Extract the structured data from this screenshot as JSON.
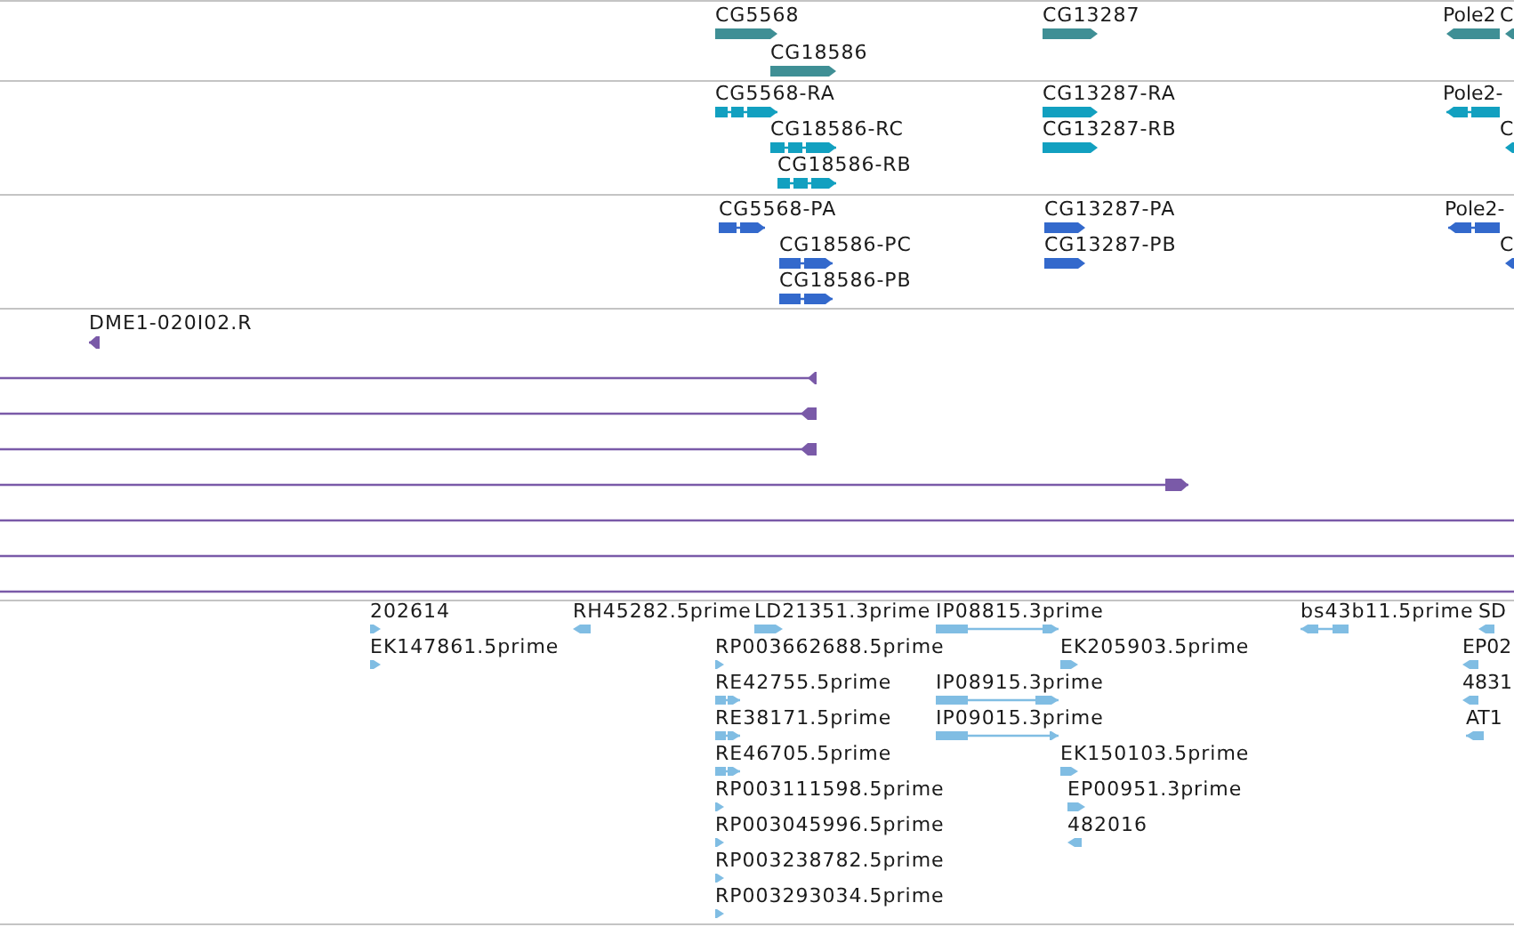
{
  "tracks": [
    {
      "kind": "gene",
      "color": "#3f8f95",
      "features": [
        {
          "label": "CG5568",
          "reverse": false
        },
        {
          "label": "CG18586",
          "reverse": false
        },
        {
          "label": "CG13287",
          "reverse": false
        },
        {
          "label": "Pole2",
          "reverse": true
        },
        {
          "label": "C",
          "reverse": true
        }
      ]
    },
    {
      "kind": "transcript",
      "color": "#12a0c0",
      "features": [
        {
          "label": "CG5568-RA",
          "reverse": false
        },
        {
          "label": "CG18586-RC",
          "reverse": false
        },
        {
          "label": "CG18586-RB",
          "reverse": false
        },
        {
          "label": "CG13287-RA",
          "reverse": false
        },
        {
          "label": "CG13287-RB",
          "reverse": false
        },
        {
          "label": "Pole2-",
          "reverse": true
        },
        {
          "label": "C",
          "reverse": true
        }
      ]
    },
    {
      "kind": "protein",
      "color": "#3369cc",
      "features": [
        {
          "label": "CG5568-PA",
          "reverse": false
        },
        {
          "label": "CG18586-PC",
          "reverse": false
        },
        {
          "label": "CG18586-PB",
          "reverse": false
        },
        {
          "label": "CG13287-PA",
          "reverse": false
        },
        {
          "label": "CG13287-PB",
          "reverse": false
        },
        {
          "label": "Pole2-",
          "reverse": true
        },
        {
          "label": "C",
          "reverse": true
        }
      ]
    },
    {
      "kind": "alignment",
      "color": "#7a5aa8",
      "features": [
        {
          "kind": "arrow",
          "label": "DME1-020I02.R",
          "reverse": true
        },
        {
          "kind": "arrow",
          "reverse": true
        },
        {
          "kind": "arrow",
          "reverse": true
        },
        {
          "kind": "arrow",
          "reverse": true
        },
        {
          "kind": "arrow",
          "reverse": false
        },
        {
          "kind": "line"
        },
        {
          "kind": "line"
        },
        {
          "kind": "line"
        }
      ]
    },
    {
      "kind": "est",
      "color": "#80bde3",
      "features": [
        {
          "label": "202614",
          "reverse": false
        },
        {
          "label": "EK147861.5prime",
          "reverse": false
        },
        {
          "label": "RH45282.5prime",
          "reverse": true
        },
        {
          "label": "LD21351.3prime",
          "reverse": false
        },
        {
          "label": "IP08815.3prime",
          "reverse": false
        },
        {
          "label": "RP003662688.5prime",
          "reverse": false
        },
        {
          "label": "RE42755.5prime",
          "reverse": false
        },
        {
          "label": "RE38171.5prime",
          "reverse": false
        },
        {
          "label": "RE46705.5prime",
          "reverse": false
        },
        {
          "label": "RP003111598.5prime",
          "reverse": false
        },
        {
          "label": "RP003045996.5prime",
          "reverse": false
        },
        {
          "label": "RP003238782.5prime",
          "reverse": false
        },
        {
          "label": "RP003293034.5prime",
          "reverse": false
        },
        {
          "label": "IP08915.3prime",
          "reverse": false
        },
        {
          "label": "IP09015.3prime",
          "reverse": false
        },
        {
          "label": "EK205903.5prime",
          "reverse": false
        },
        {
          "label": "EK150103.5prime",
          "reverse": false
        },
        {
          "label": "EP00951.3prime",
          "reverse": false
        },
        {
          "label": "482016",
          "reverse": true
        },
        {
          "label": "bs43b11.5prime",
          "reverse": true
        },
        {
          "label": "SD",
          "reverse": true
        },
        {
          "label": "EP02",
          "reverse": true
        },
        {
          "label": "4831",
          "reverse": true
        },
        {
          "label": "AT1",
          "reverse": true
        }
      ]
    }
  ]
}
